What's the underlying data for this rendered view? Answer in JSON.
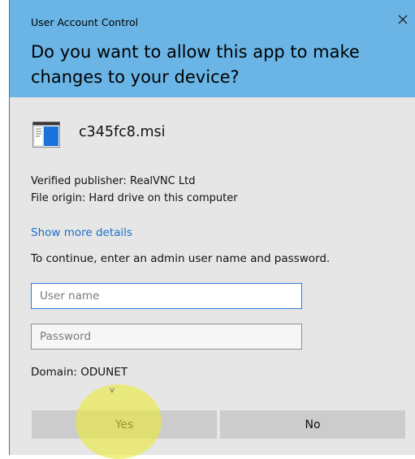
{
  "dialog": {
    "window_title": "User Account Control",
    "question": "Do you want to allow this app to make changes to your device?",
    "app_name": "c345fc8.msi",
    "publisher": "Verified publisher: RealVNC Ltd",
    "origin": "File origin: Hard drive on this computer",
    "show_more": "Show more details",
    "instruction": "To continue, enter an admin user name and password.",
    "username_placeholder": "User name",
    "password_placeholder": "Password",
    "domain": "Domain: ODUNET",
    "yes_label": "Yes",
    "no_label": "No",
    "cursor_glyph": "v"
  },
  "colors": {
    "header": "#6ab5e6",
    "body": "#e6e6e6",
    "link": "#1a6fc7",
    "button": "#cccccc",
    "focus_border": "#2b7fd6"
  },
  "icons": {
    "close": "close-icon",
    "app": "msi-installer-icon"
  }
}
